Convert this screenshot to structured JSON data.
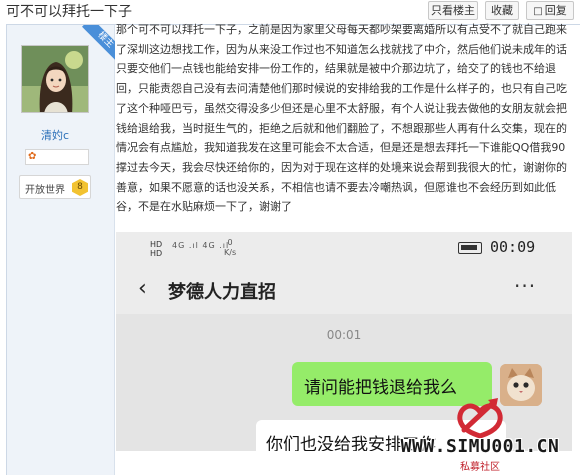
{
  "header": {
    "thread_title": "可不可以拜托一下子",
    "author_only_label": "只看楼主",
    "favorite_label": "收藏",
    "reply_label": "回复"
  },
  "author": {
    "ribbon": "楼主",
    "username": "清妁c",
    "level_name": "开放世界",
    "level_number": "8"
  },
  "post": {
    "body": "那个可不可以拜托一下子，之前是因为家里父母每天都吵架要离婚所以有点受不了就自己跑来了深圳这边想找工作，因为从来没工作过也不知道怎么找就找了中介，然后他们说未成年的话只要交他们一点钱也能给安排一份工作的，结果就是被中介那边坑了，给交了的钱也不给退回，只能责怨自己没有去问清楚他们那时候说的安排给我的工作是什么样子的，也只有自己吃了这个种哑巴亏，虽然交得没多少但还是心里不太舒服，有个人说让我去做他的女朋友就会把钱给退给我，当时挺生气的，拒绝之后就和他们翻脸了，不想跟那些人再有什么交集，现在的情况会有点尴尬，我知道我发在这里可能会不太合适，但是还是想去拜托一下谁能QQ借我90撑过去今天，我会尽快还给你的，因为对于现在这样的处境来说会帮到我很大的忙，谢谢你的善意，如果不愿意的话也没关系，不相信也请不要去冷嘲热讽，但愿谁也不会经历到如此低谷，不是在水贴麻烦一下了，谢谢了"
  },
  "screenshot": {
    "status_hd_top": "HD",
    "status_hd_bottom": "HD",
    "status_signal": "4G .ıl 4G .ıl",
    "status_speed_value": "0",
    "status_speed_unit": "K/s",
    "status_time": "00:09",
    "chat_name": "梦德人力直招",
    "chat_time": "00:01",
    "message_me": "请问能把钱退给我么",
    "message_other": "你们也没给我安排工作"
  },
  "watermark": {
    "url": "WWW.SIMU001.CN",
    "subtitle": "私募社区"
  },
  "colors": {
    "link_blue": "#2a6fb8",
    "ribbon_blue": "#4a8fd9",
    "wechat_green": "#95ec69",
    "watermark_red": "#c0202b"
  }
}
